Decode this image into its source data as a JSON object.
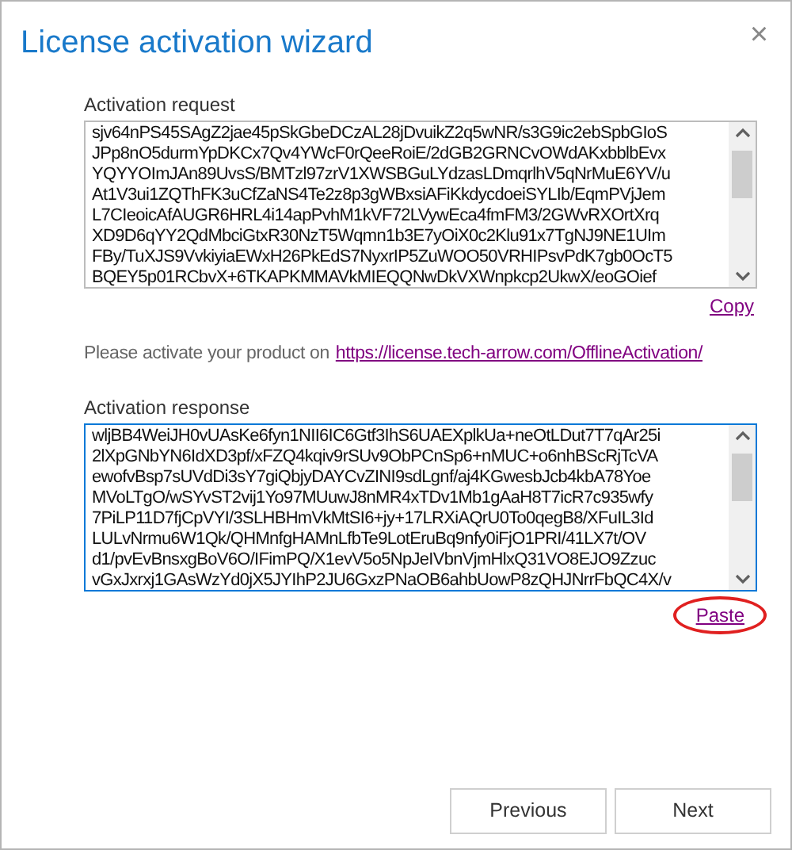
{
  "window": {
    "title": "License activation wizard",
    "close": "×"
  },
  "request": {
    "label": "Activation request",
    "lines": [
      "sjv64nPS45SAgZ2jae45pSkGbeDCzAL28jDvuikZ2q5wNR/s3G9ic2ebSpbGIoS",
      "JPp8nO5durmYpDKCx7Qv4YWcF0rQeeRoiE/2dGB2GRNCvOWdAKxbblbEvx",
      "YQYYOImJAn89UvsS/BMTzl97zrV1XWSBGuLYdzasLDmqrlhV5qNrMuE6YV/u",
      "At1V3ui1ZQThFK3uCfZaNS4Te2z8p3gWBxsiAFiKkdycdoeiSYLIb/EqmPVjJem",
      "L7CIeoicAfAUGR6HRL4i14apPvhM1kVF72LVywEca4fmFM3/2GWvRXOrtXrq",
      "XD9D6qYY2QdMbciGtxR30NzT5Wqmn1b3E7yOiX0c2Klu91x7TgNJ9NE1UIm",
      "FBy/TuXJS9VvkiyiaEWxH26PkEdS7NyxrIP5ZuWOO50VRHIPsvPdK7gb0OcT5",
      "BQEY5p01RCbvX+6TKAPKMMAVkMIEQQNwDkVXWnpkcp2UkwX/eoGOief"
    ],
    "focused": false,
    "link": "Copy"
  },
  "instruction": {
    "text": "Please activate your product on",
    "link": "https://license.tech-arrow.com/OfflineActivation/"
  },
  "response": {
    "label": "Activation response",
    "lines": [
      "wljBB4WeiJH0vUAsKe6fyn1NII6IC6Gtf3IhS6UAEXplkUa+neOtLDut7T7qAr25i",
      "2lXpGNbYN6IdXD3pf/xFZQ4kqiv9rSUv9ObPCnSp6+nMUC+o6nhBScRjTcVA",
      "ewofvBsp7sUVdDi3sY7giQbjyDAYCvZINI9sdLgnf/aj4KGwesbJcb4kbA78Yoe",
      "MVoLTgO/wSYvST2vij1Yo97MUuwJ8nMR4xTDv1Mb1gAaH8T7icR7c935wfy",
      "7PiLP11D7fjCpVYI/3SLHBHmVkMtSI6+jy+17LRXiAQrU0To0qegB8/XFuIL3Id",
      "LULvNrmu6W1Qk/QHMnfgHAMnLfbTe9LotEruBq9nfy0iFjO1PRI/41LX7t/OV",
      "d1/pvEvBnsxgBoV6O/IFimPQ/X1evV5o5NpJeIVbnVjmHlxQ31VO8EJO9Zzuc",
      "vGxJxrxj1GAsWzYd0jX5JYIhP2JU6GxzPNaOB6ahbUowP8zQHJNrrFbQC4X/v"
    ],
    "focused": true,
    "link": "Paste",
    "circled": true
  },
  "buttons": [
    "Previous",
    "Next"
  ]
}
